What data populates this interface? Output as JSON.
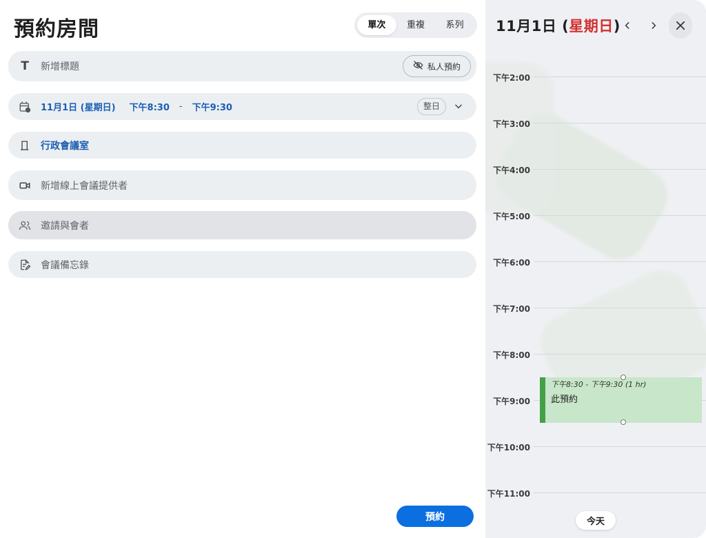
{
  "form": {
    "title": "預約房間",
    "tabs": [
      {
        "label": "單次",
        "active": true
      },
      {
        "label": "重複",
        "active": false
      },
      {
        "label": "系列",
        "active": false
      }
    ],
    "title_field": {
      "placeholder": "新增標題",
      "private_label": "私人預約"
    },
    "date_field": {
      "date": "11月1日 (星期日)",
      "start": "下午8:30",
      "separator": "-",
      "end": "下午9:30",
      "all_day_label": "整日"
    },
    "room": "行政會議室",
    "online_placeholder": "新增線上會議提供者",
    "invite_placeholder": "邀請與會者",
    "notes_placeholder": "會議備忘錄",
    "submit_label": "預約"
  },
  "calendar": {
    "date_prefix": "11月1日 (",
    "weekday": "星期日",
    "date_suffix": ")",
    "hours": [
      "下午2:00",
      "下午3:00",
      "下午4:00",
      "下午5:00",
      "下午6:00",
      "下午7:00",
      "下午8:00",
      "下午9:00",
      "下午10:00",
      "下午11:00"
    ],
    "event": {
      "time": "下午8:30 - 下午9:30 (1 hr)",
      "title": "此預約"
    },
    "today_label": "今天"
  },
  "colors": {
    "accent": "#0b6fe0",
    "link": "#1a5fb4",
    "weekday_red": "#d32f2f",
    "event_bg": "#c8e6c9",
    "event_bar": "#43a047"
  }
}
